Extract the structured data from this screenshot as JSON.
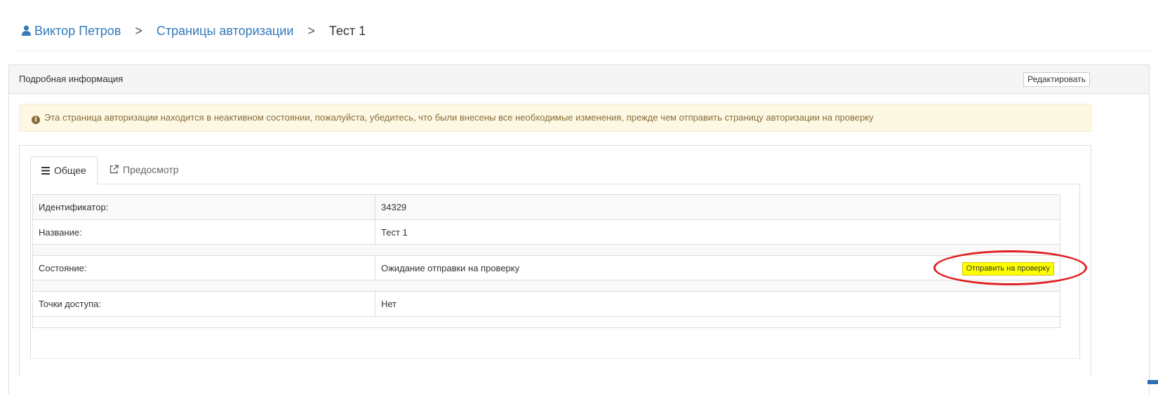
{
  "breadcrumb": {
    "user": "Виктор Петров",
    "section": "Страницы авторизации",
    "current": "Тест 1",
    "separator": ">"
  },
  "panel": {
    "title": "Подробная информация",
    "edit_label": "Редактировать"
  },
  "alert": {
    "text": "Эта страница авторизации находится в неактивном состоянии, пожалуйста, убедитесь, что были внесены все необходимые изменения, прежде чем отправить страницу авторизации на проверку"
  },
  "tabs": [
    {
      "label": "Общее",
      "icon": "list-icon",
      "active": true
    },
    {
      "label": "Предосмотр",
      "icon": "external-link-icon",
      "active": false
    }
  ],
  "details": {
    "id_label": "Идентификатор:",
    "id_value": "34329",
    "name_label": "Название:",
    "name_value": "Тест 1",
    "state_label": "Состояние:",
    "state_value": "Ожидание отправки на проверку",
    "submit_label": "Отправить на проверку",
    "access_label": "Точки доступа:",
    "access_value": "Нет"
  },
  "colors": {
    "link": "#337ab7",
    "alert_bg": "#fcf8e3",
    "alert_text": "#8a6d3b",
    "submit_bg": "#ffff00",
    "highlight": "#e02020"
  }
}
